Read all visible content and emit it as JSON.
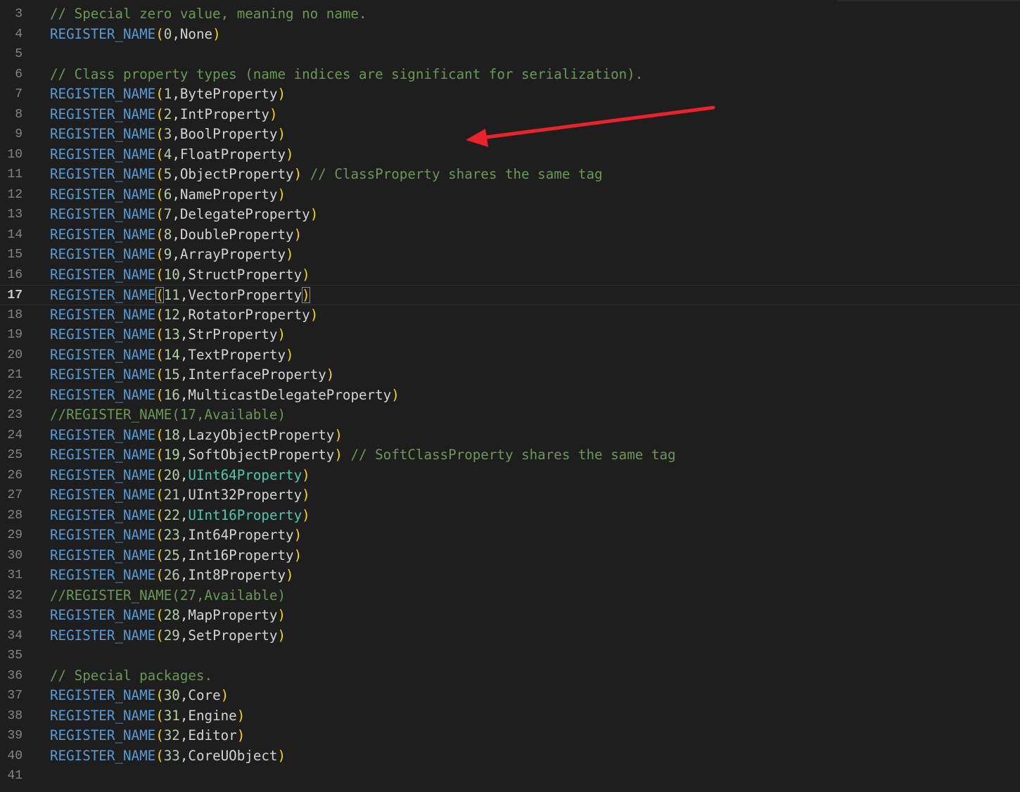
{
  "editor": {
    "active_line": "17",
    "lines": [
      {
        "num": "3",
        "tokens": [
          {
            "t": "// Special zero value, meaning no name.",
            "c": "comment"
          }
        ]
      },
      {
        "num": "4",
        "tokens": [
          {
            "t": "REGISTER_NAME",
            "c": "macro"
          },
          {
            "t": "(",
            "c": "paren"
          },
          {
            "t": "0",
            "c": "num"
          },
          {
            "t": ",None",
            "c": "text"
          },
          {
            "t": ")",
            "c": "paren"
          }
        ]
      },
      {
        "num": "5",
        "tokens": []
      },
      {
        "num": "6",
        "tokens": [
          {
            "t": "// Class property types (name indices are significant for serialization).",
            "c": "comment"
          }
        ]
      },
      {
        "num": "7",
        "tokens": [
          {
            "t": "REGISTER_NAME",
            "c": "macro"
          },
          {
            "t": "(",
            "c": "paren"
          },
          {
            "t": "1",
            "c": "num"
          },
          {
            "t": ",ByteProperty",
            "c": "text"
          },
          {
            "t": ")",
            "c": "paren"
          }
        ]
      },
      {
        "num": "8",
        "tokens": [
          {
            "t": "REGISTER_NAME",
            "c": "macro"
          },
          {
            "t": "(",
            "c": "paren"
          },
          {
            "t": "2",
            "c": "num"
          },
          {
            "t": ",IntProperty",
            "c": "text"
          },
          {
            "t": ")",
            "c": "paren"
          }
        ]
      },
      {
        "num": "9",
        "tokens": [
          {
            "t": "REGISTER_NAME",
            "c": "macro"
          },
          {
            "t": "(",
            "c": "paren"
          },
          {
            "t": "3",
            "c": "num"
          },
          {
            "t": ",BoolProperty",
            "c": "text"
          },
          {
            "t": ")",
            "c": "paren"
          }
        ]
      },
      {
        "num": "10",
        "tokens": [
          {
            "t": "REGISTER_NAME",
            "c": "macro"
          },
          {
            "t": "(",
            "c": "paren"
          },
          {
            "t": "4",
            "c": "num"
          },
          {
            "t": ",FloatProperty",
            "c": "text"
          },
          {
            "t": ")",
            "c": "paren"
          }
        ]
      },
      {
        "num": "11",
        "tokens": [
          {
            "t": "REGISTER_NAME",
            "c": "macro"
          },
          {
            "t": "(",
            "c": "paren"
          },
          {
            "t": "5",
            "c": "num"
          },
          {
            "t": ",ObjectProperty",
            "c": "text"
          },
          {
            "t": ")",
            "c": "paren"
          },
          {
            "t": " // ClassProperty shares the same tag",
            "c": "comment"
          }
        ]
      },
      {
        "num": "12",
        "tokens": [
          {
            "t": "REGISTER_NAME",
            "c": "macro"
          },
          {
            "t": "(",
            "c": "paren"
          },
          {
            "t": "6",
            "c": "num"
          },
          {
            "t": ",NameProperty",
            "c": "text"
          },
          {
            "t": ")",
            "c": "paren"
          }
        ]
      },
      {
        "num": "13",
        "tokens": [
          {
            "t": "REGISTER_NAME",
            "c": "macro"
          },
          {
            "t": "(",
            "c": "paren"
          },
          {
            "t": "7",
            "c": "num"
          },
          {
            "t": ",DelegateProperty",
            "c": "text"
          },
          {
            "t": ")",
            "c": "paren"
          }
        ]
      },
      {
        "num": "14",
        "tokens": [
          {
            "t": "REGISTER_NAME",
            "c": "macro"
          },
          {
            "t": "(",
            "c": "paren"
          },
          {
            "t": "8",
            "c": "num"
          },
          {
            "t": ",DoubleProperty",
            "c": "text"
          },
          {
            "t": ")",
            "c": "paren"
          }
        ]
      },
      {
        "num": "15",
        "tokens": [
          {
            "t": "REGISTER_NAME",
            "c": "macro"
          },
          {
            "t": "(",
            "c": "paren"
          },
          {
            "t": "9",
            "c": "num"
          },
          {
            "t": ",ArrayProperty",
            "c": "text"
          },
          {
            "t": ")",
            "c": "paren"
          }
        ]
      },
      {
        "num": "16",
        "tokens": [
          {
            "t": "REGISTER_NAME",
            "c": "macro"
          },
          {
            "t": "(",
            "c": "paren"
          },
          {
            "t": "10",
            "c": "num"
          },
          {
            "t": ",StructProperty",
            "c": "text"
          },
          {
            "t": ")",
            "c": "paren"
          }
        ]
      },
      {
        "num": "17",
        "tokens": [
          {
            "t": "REGISTER_NAME",
            "c": "macro"
          },
          {
            "t": "(",
            "c": "paren-match"
          },
          {
            "t": "11",
            "c": "num"
          },
          {
            "t": ",VectorProperty",
            "c": "text"
          },
          {
            "t": ")",
            "c": "paren-match"
          }
        ]
      },
      {
        "num": "18",
        "tokens": [
          {
            "t": "REGISTER_NAME",
            "c": "macro"
          },
          {
            "t": "(",
            "c": "paren"
          },
          {
            "t": "12",
            "c": "num"
          },
          {
            "t": ",RotatorProperty",
            "c": "text"
          },
          {
            "t": ")",
            "c": "paren"
          }
        ]
      },
      {
        "num": "19",
        "tokens": [
          {
            "t": "REGISTER_NAME",
            "c": "macro"
          },
          {
            "t": "(",
            "c": "paren"
          },
          {
            "t": "13",
            "c": "num"
          },
          {
            "t": ",StrProperty",
            "c": "text"
          },
          {
            "t": ")",
            "c": "paren"
          }
        ]
      },
      {
        "num": "20",
        "tokens": [
          {
            "t": "REGISTER_NAME",
            "c": "macro"
          },
          {
            "t": "(",
            "c": "paren"
          },
          {
            "t": "14",
            "c": "num"
          },
          {
            "t": ",TextProperty",
            "c": "text"
          },
          {
            "t": ")",
            "c": "paren"
          }
        ]
      },
      {
        "num": "21",
        "tokens": [
          {
            "t": "REGISTER_NAME",
            "c": "macro"
          },
          {
            "t": "(",
            "c": "paren"
          },
          {
            "t": "15",
            "c": "num"
          },
          {
            "t": ",InterfaceProperty",
            "c": "text"
          },
          {
            "t": ")",
            "c": "paren"
          }
        ]
      },
      {
        "num": "22",
        "tokens": [
          {
            "t": "REGISTER_NAME",
            "c": "macro"
          },
          {
            "t": "(",
            "c": "paren"
          },
          {
            "t": "16",
            "c": "num"
          },
          {
            "t": ",MulticastDelegateProperty",
            "c": "text"
          },
          {
            "t": ")",
            "c": "paren"
          }
        ]
      },
      {
        "num": "23",
        "tokens": [
          {
            "t": "//REGISTER_NAME(17,Available)",
            "c": "comment"
          }
        ]
      },
      {
        "num": "24",
        "tokens": [
          {
            "t": "REGISTER_NAME",
            "c": "macro"
          },
          {
            "t": "(",
            "c": "paren"
          },
          {
            "t": "18",
            "c": "num"
          },
          {
            "t": ",LazyObjectProperty",
            "c": "text"
          },
          {
            "t": ")",
            "c": "paren"
          }
        ]
      },
      {
        "num": "25",
        "tokens": [
          {
            "t": "REGISTER_NAME",
            "c": "macro"
          },
          {
            "t": "(",
            "c": "paren"
          },
          {
            "t": "19",
            "c": "num"
          },
          {
            "t": ",SoftObjectProperty",
            "c": "text"
          },
          {
            "t": ")",
            "c": "paren"
          },
          {
            "t": " // SoftClassProperty shares the same tag",
            "c": "comment"
          }
        ]
      },
      {
        "num": "26",
        "tokens": [
          {
            "t": "REGISTER_NAME",
            "c": "macro"
          },
          {
            "t": "(",
            "c": "paren"
          },
          {
            "t": "20",
            "c": "num"
          },
          {
            "t": ",",
            "c": "text"
          },
          {
            "t": "UInt64Property",
            "c": "type"
          },
          {
            "t": ")",
            "c": "paren"
          }
        ]
      },
      {
        "num": "27",
        "tokens": [
          {
            "t": "REGISTER_NAME",
            "c": "macro"
          },
          {
            "t": "(",
            "c": "paren"
          },
          {
            "t": "21",
            "c": "num"
          },
          {
            "t": ",UInt32Property",
            "c": "text"
          },
          {
            "t": ")",
            "c": "paren"
          }
        ]
      },
      {
        "num": "28",
        "tokens": [
          {
            "t": "REGISTER_NAME",
            "c": "macro"
          },
          {
            "t": "(",
            "c": "paren"
          },
          {
            "t": "22",
            "c": "num"
          },
          {
            "t": ",",
            "c": "text"
          },
          {
            "t": "UInt16Property",
            "c": "type"
          },
          {
            "t": ")",
            "c": "paren"
          }
        ]
      },
      {
        "num": "29",
        "tokens": [
          {
            "t": "REGISTER_NAME",
            "c": "macro"
          },
          {
            "t": "(",
            "c": "paren"
          },
          {
            "t": "23",
            "c": "num"
          },
          {
            "t": ",Int64Property",
            "c": "text"
          },
          {
            "t": ")",
            "c": "paren"
          }
        ]
      },
      {
        "num": "30",
        "tokens": [
          {
            "t": "REGISTER_NAME",
            "c": "macro"
          },
          {
            "t": "(",
            "c": "paren"
          },
          {
            "t": "25",
            "c": "num"
          },
          {
            "t": ",Int16Property",
            "c": "text"
          },
          {
            "t": ")",
            "c": "paren"
          }
        ]
      },
      {
        "num": "31",
        "tokens": [
          {
            "t": "REGISTER_NAME",
            "c": "macro"
          },
          {
            "t": "(",
            "c": "paren"
          },
          {
            "t": "26",
            "c": "num"
          },
          {
            "t": ",Int8Property",
            "c": "text"
          },
          {
            "t": ")",
            "c": "paren"
          }
        ]
      },
      {
        "num": "32",
        "tokens": [
          {
            "t": "//REGISTER_NAME(27,Available)",
            "c": "comment"
          }
        ]
      },
      {
        "num": "33",
        "tokens": [
          {
            "t": "REGISTER_NAME",
            "c": "macro"
          },
          {
            "t": "(",
            "c": "paren"
          },
          {
            "t": "28",
            "c": "num"
          },
          {
            "t": ",MapProperty",
            "c": "text"
          },
          {
            "t": ")",
            "c": "paren"
          }
        ]
      },
      {
        "num": "34",
        "tokens": [
          {
            "t": "REGISTER_NAME",
            "c": "macro"
          },
          {
            "t": "(",
            "c": "paren"
          },
          {
            "t": "29",
            "c": "num"
          },
          {
            "t": ",SetProperty",
            "c": "text"
          },
          {
            "t": ")",
            "c": "paren"
          }
        ]
      },
      {
        "num": "35",
        "tokens": []
      },
      {
        "num": "36",
        "tokens": [
          {
            "t": "// Special packages.",
            "c": "comment"
          }
        ]
      },
      {
        "num": "37",
        "tokens": [
          {
            "t": "REGISTER_NAME",
            "c": "macro"
          },
          {
            "t": "(",
            "c": "paren"
          },
          {
            "t": "30",
            "c": "num"
          },
          {
            "t": ",Core",
            "c": "text"
          },
          {
            "t": ")",
            "c": "paren"
          }
        ]
      },
      {
        "num": "38",
        "tokens": [
          {
            "t": "REGISTER_NAME",
            "c": "macro"
          },
          {
            "t": "(",
            "c": "paren"
          },
          {
            "t": "31",
            "c": "num"
          },
          {
            "t": ",Engine",
            "c": "text"
          },
          {
            "t": ")",
            "c": "paren"
          }
        ]
      },
      {
        "num": "39",
        "tokens": [
          {
            "t": "REGISTER_NAME",
            "c": "macro"
          },
          {
            "t": "(",
            "c": "paren"
          },
          {
            "t": "32",
            "c": "num"
          },
          {
            "t": ",Editor",
            "c": "text"
          },
          {
            "t": ")",
            "c": "paren"
          }
        ]
      },
      {
        "num": "40",
        "tokens": [
          {
            "t": "REGISTER_NAME",
            "c": "macro"
          },
          {
            "t": "(",
            "c": "paren"
          },
          {
            "t": "33",
            "c": "num"
          },
          {
            "t": ",CoreUObject",
            "c": "text"
          },
          {
            "t": ")",
            "c": "paren"
          }
        ]
      },
      {
        "num": "41",
        "tokens": []
      }
    ]
  },
  "colors": {
    "background": "#1e1e1e",
    "line_number": "#858585",
    "active_line_number": "#c6c6c6",
    "macro": "#569cd6",
    "bracket": "#ffd700",
    "number": "#b5cea8",
    "identifier": "#d4d4d4",
    "type": "#4ec9b0",
    "comment": "#6a9955",
    "annotation_arrow": "#e8232b"
  }
}
